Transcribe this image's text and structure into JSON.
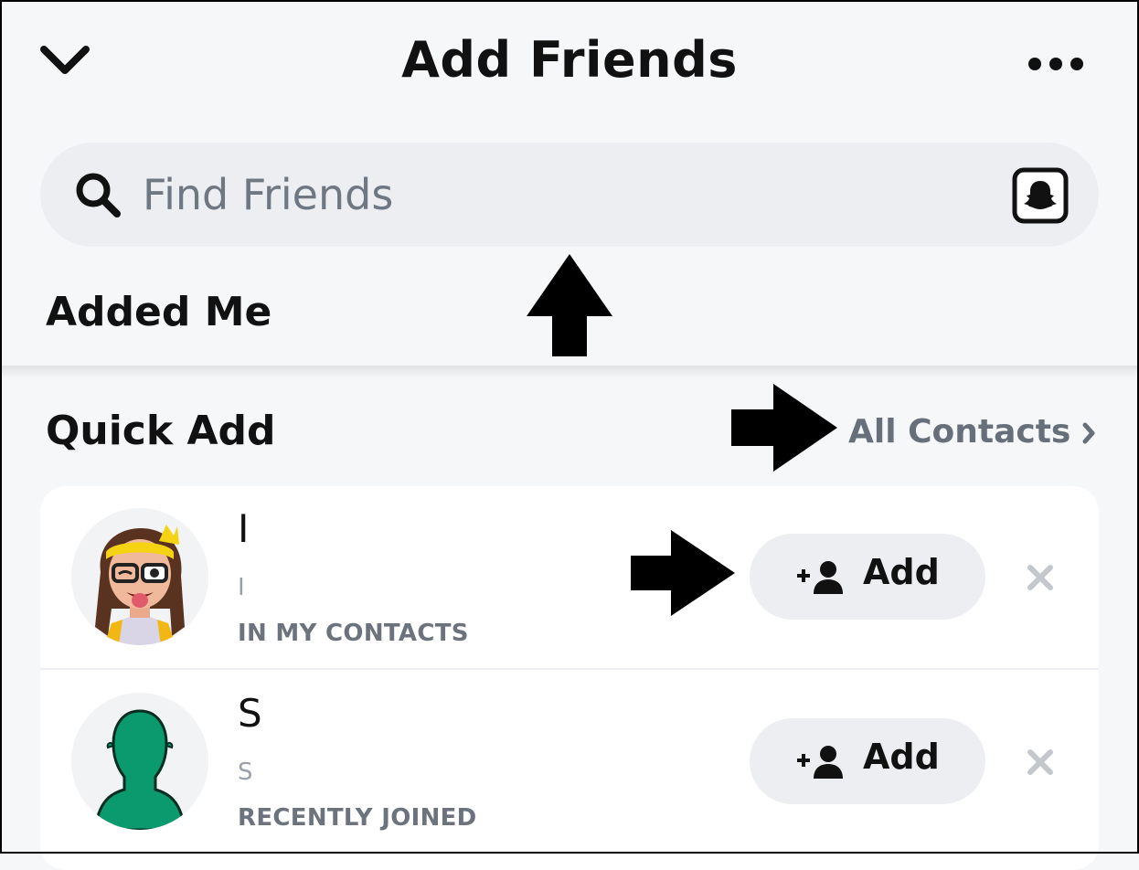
{
  "header": {
    "title": "Add Friends",
    "back_icon": "chevron-down-icon",
    "more_icon": "more-horizontal-icon"
  },
  "search": {
    "placeholder": "Find Friends",
    "icon": "search-icon",
    "snapcode_icon": "snapcode-icon"
  },
  "sections": {
    "added_me": "Added Me",
    "quick_add": "Quick Add",
    "all_contacts_label": "All Contacts"
  },
  "quick_add_list": [
    {
      "name": "I",
      "username": "I",
      "reason": "IN MY CONTACTS",
      "avatar": "bitmoji-avatar",
      "add_label": "Add"
    },
    {
      "name": "S",
      "username": "S",
      "reason": "RECENTLY JOINED",
      "avatar": "default-silhouette-avatar",
      "add_label": "Add"
    }
  ],
  "colors": {
    "background": "#f6f7f9",
    "search_bg": "#eceef1",
    "secondary_text": "#6c737d",
    "silhouette_green": "#0b9a6d"
  },
  "annotations": [
    "arrow-up",
    "arrow-right",
    "arrow-right"
  ]
}
